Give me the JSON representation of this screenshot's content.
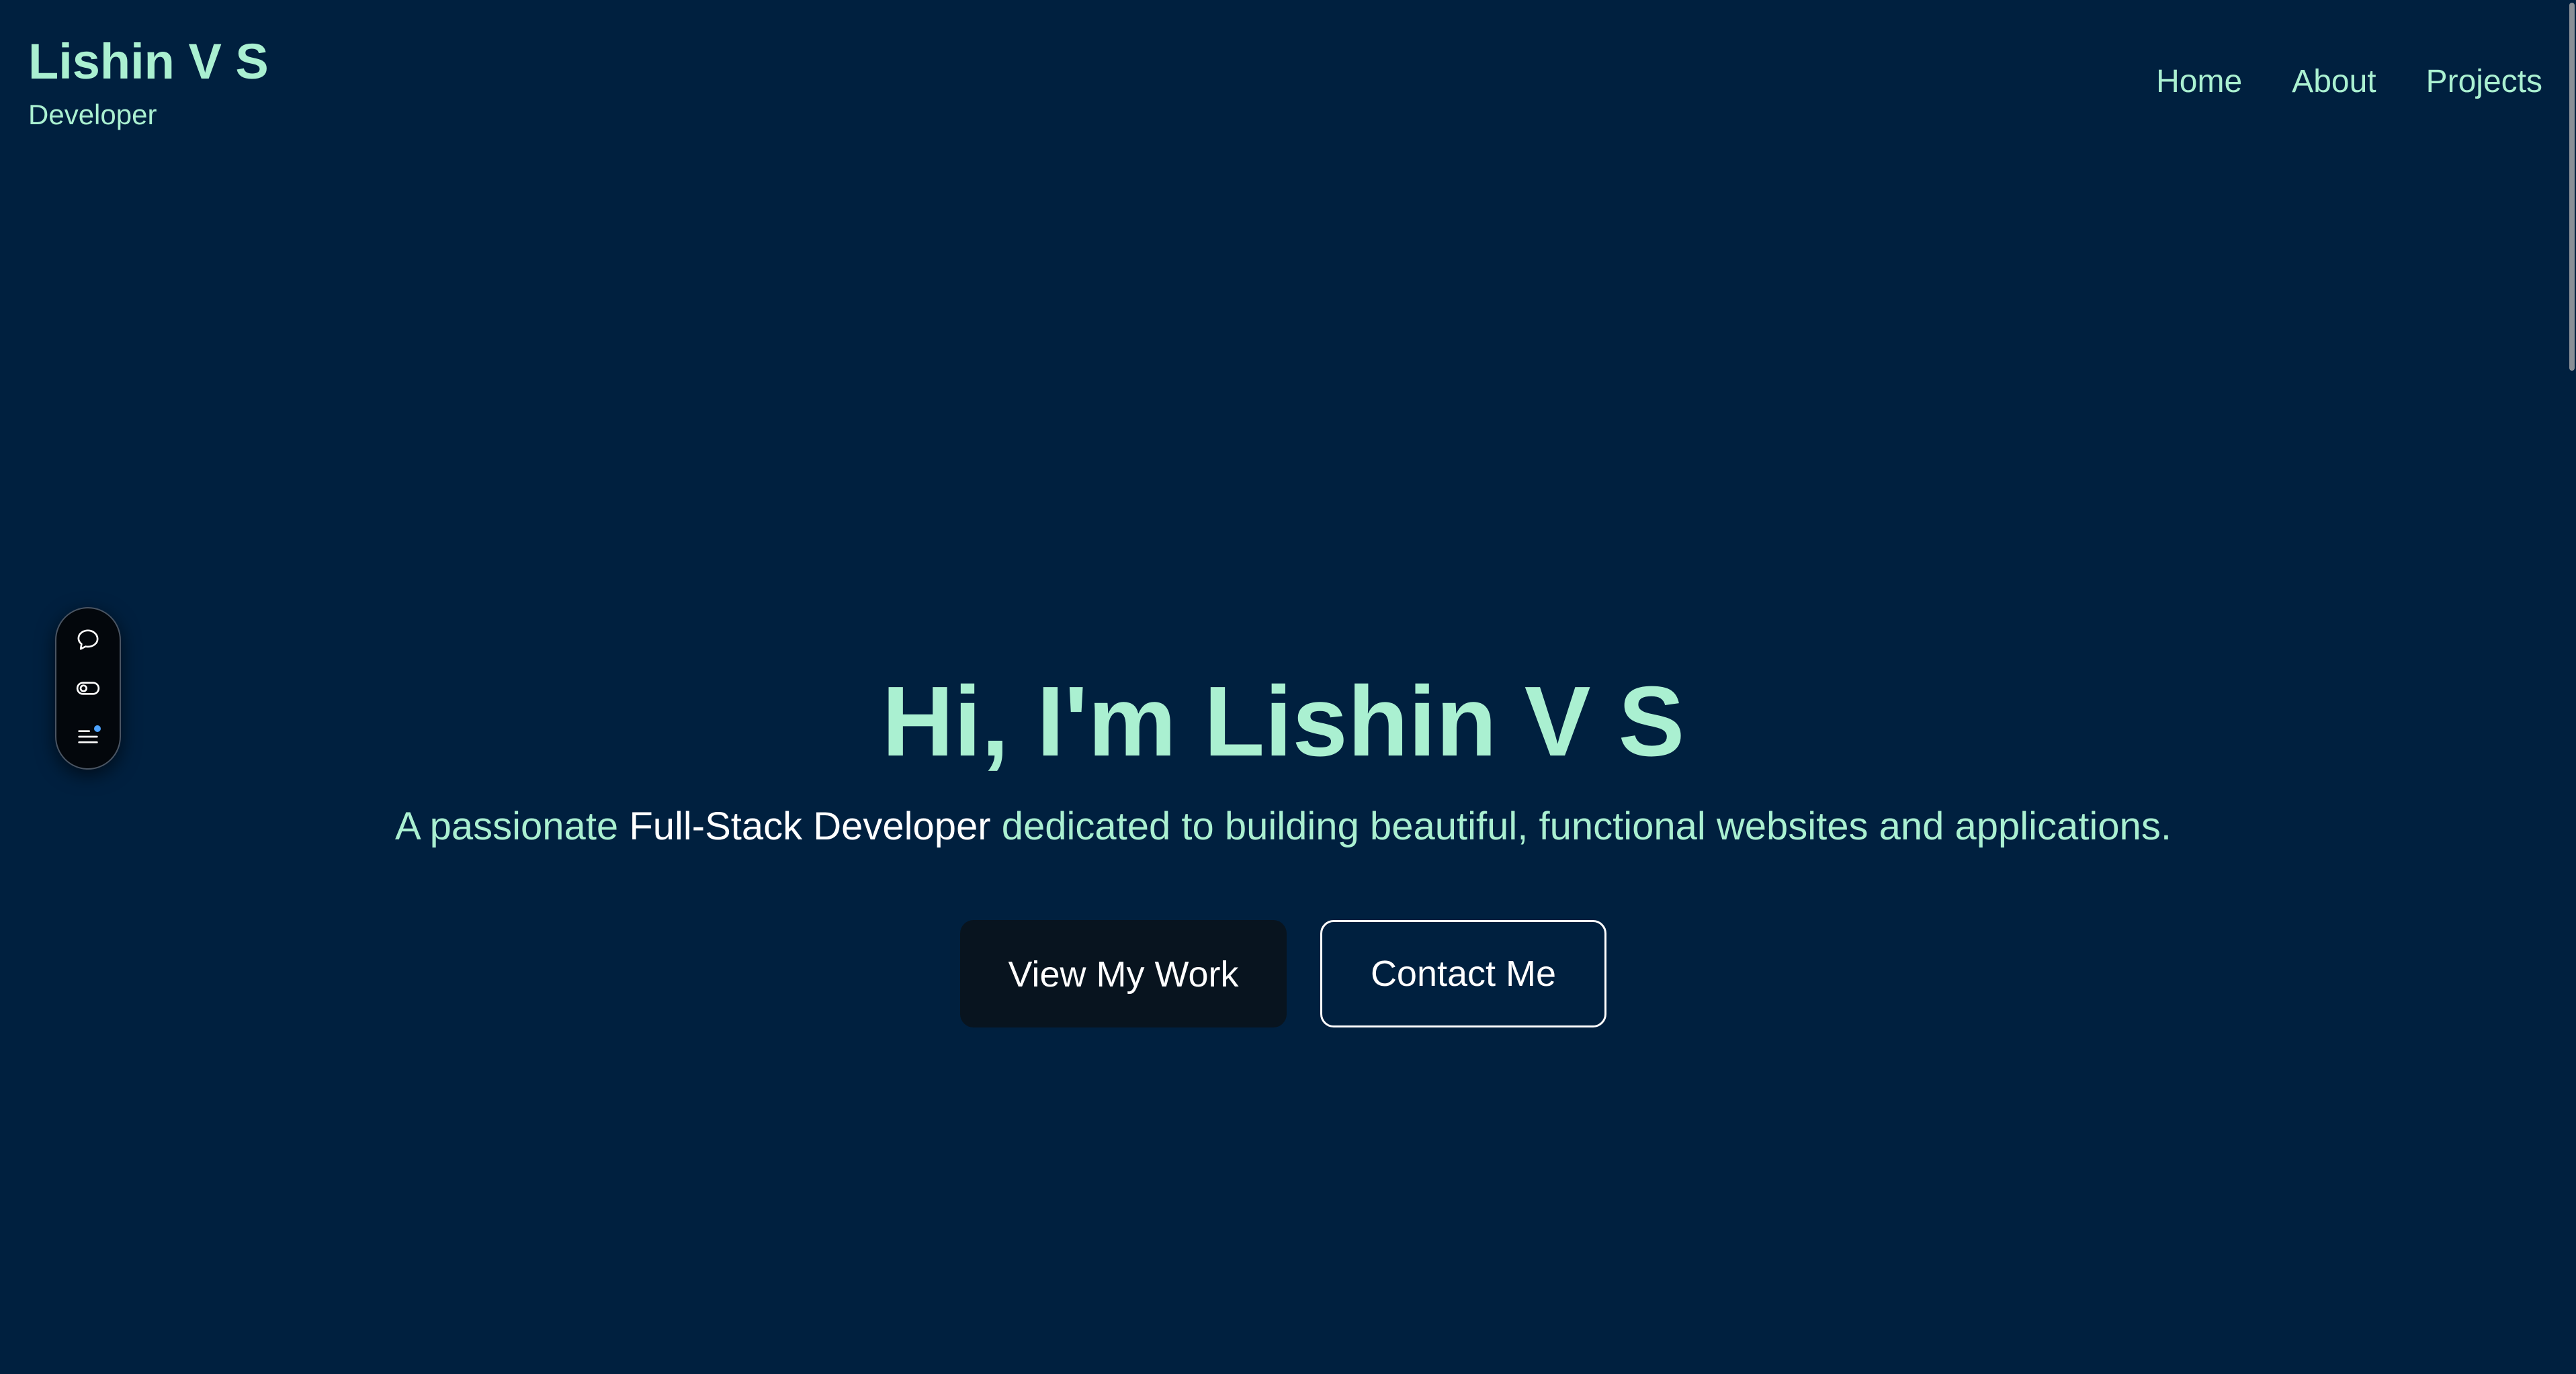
{
  "header": {
    "brand_title": "Lishin V S",
    "brand_subtitle": "Developer",
    "nav": [
      {
        "label": "Home"
      },
      {
        "label": "About"
      },
      {
        "label": "Projects"
      }
    ]
  },
  "side_toolbar": {
    "icons": [
      "chat-bubble-icon",
      "toggle-icon",
      "menu-icon"
    ]
  },
  "hero": {
    "title": "Hi, I'm Lishin V S",
    "tagline_prefix": "A passionate ",
    "tagline_highlight": "Full-Stack Developer",
    "tagline_suffix": " dedicated to building beautiful, functional websites and applications."
  },
  "cta": {
    "primary_label": "View My Work",
    "secondary_label": "Contact Me"
  },
  "colors": {
    "background": "#00203f",
    "accent": "#aaf0d1",
    "button_dark": "#08141f",
    "notification_dot": "#4da3ff"
  }
}
